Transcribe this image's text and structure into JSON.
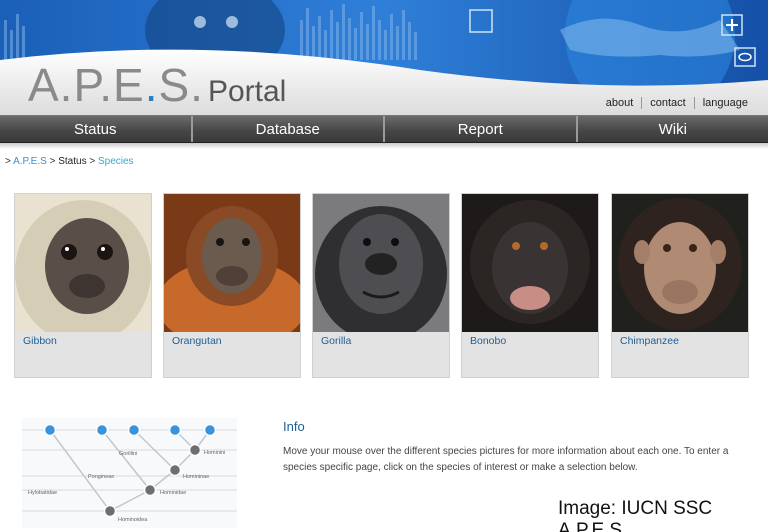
{
  "logo": {
    "part1": "A.P.E",
    "dot": ".",
    "part2": "S.",
    "portal": "Portal"
  },
  "toplinks": [
    "about",
    "contact",
    "language"
  ],
  "nav": [
    "Status",
    "Database",
    "Report",
    "Wiki"
  ],
  "breadcrumb": {
    "sep": ">",
    "home": "A.P.E.S",
    "status": "Status",
    "current": "Species"
  },
  "species": [
    {
      "name": "Gibbon",
      "fur": "#cfc6b0",
      "face": "#5a4f48"
    },
    {
      "name": "Orangutan",
      "fur": "#b8642a",
      "face": "#6b5a4e"
    },
    {
      "name": "Gorilla",
      "fur": "#3a3a3c",
      "face": "#4e4e52"
    },
    {
      "name": "Bonobo",
      "fur": "#2b2524",
      "face": "#3a3333"
    },
    {
      "name": "Chimpanzee",
      "fur": "#2e231f",
      "face": "#b08a73"
    }
  ],
  "tree": {
    "labels": [
      "Gorillini",
      "Hominini",
      "Pongineae",
      "Homininae",
      "Hylobatidae",
      "Hominidae",
      "Hominoidea"
    ]
  },
  "info": {
    "title": "Info",
    "text": "Move your mouse over the different species pictures for more information about each one. To enter a species specific page, click on the species of interest or make a selection below."
  },
  "credit": "Image:  IUCN SSC A.P.E.S",
  "colors": {
    "banner_blue": "#1f66c4",
    "accent": "#2a7fc4",
    "link": "#1f5f96"
  }
}
